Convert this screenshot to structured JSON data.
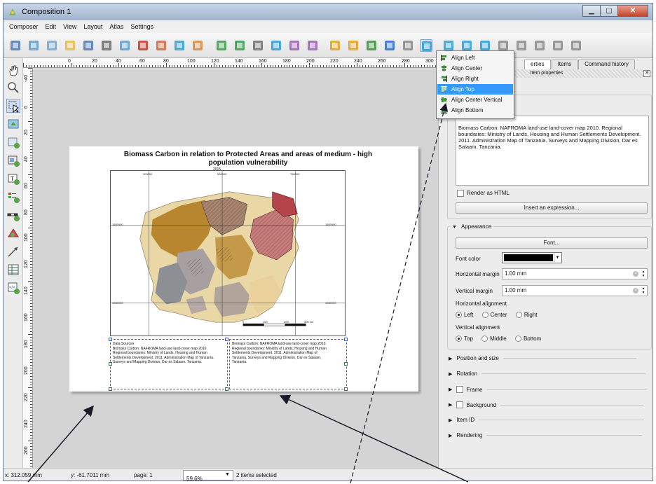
{
  "window": {
    "title": "Composition 1"
  },
  "menu": [
    "Composer",
    "Edit",
    "View",
    "Layout",
    "Atlas",
    "Settings"
  ],
  "toolbar_icons": [
    "save-icon",
    "new-composition-icon",
    "duplicate-icon",
    "manager-icon",
    "open-template-icon",
    "save-template-icon",
    "print-icon",
    "export-image-icon",
    "export-svg-icon",
    "export-pdf-icon",
    "undo-icon",
    "redo-icon",
    "zoom-full-icon",
    "zoom-in-icon",
    "zoom-out-icon",
    "zoom-100-icon",
    "refresh-icon",
    "group-icon",
    "ungroup-icon",
    "lock-icon",
    "unlock-icon",
    "raise-icon",
    "align-icon",
    "atlas-preview-icon",
    "first-feature-icon",
    "previous-feature-icon",
    "next-feature-icon",
    "last-feature-icon",
    "print-atlas-icon",
    "export-atlas-icon",
    "atlas-settings-icon"
  ],
  "ruler": {
    "h_labels": [
      "0",
      "20",
      "40",
      "60",
      "80",
      "100",
      "120",
      "140",
      "160",
      "180",
      "200",
      "220",
      "240",
      "260",
      "280",
      "300"
    ],
    "v_labels": [
      "-40",
      "0",
      "20",
      "40",
      "60",
      "80",
      "100",
      "120",
      "140",
      "160",
      "180",
      "200",
      "220",
      "240",
      "260"
    ]
  },
  "map": {
    "title": "Biomass Carbon in relation to Protected Areas and areas of medium - high population vulnerability",
    "year": "2015",
    "coords": [
      "200000",
      "500000",
      "750000",
      "1500000",
      "1250000",
      "1000000"
    ],
    "scale_labels": [
      "0",
      "100",
      "200",
      "300 km"
    ],
    "legend_left": "Data Sources:\nBiomass Carbon: NAFROMA land-use land-cover map 2010.\nRegional boundaries: Ministry of Lands, Housing and Human\nSettlements Development. 2011. Administration Map of Tanzania.\nSurveys and Mapping Division, Dar es Salaam. Tanzania.",
    "legend_right": "Biomass Carbon: NAFROMA land-use land-cover map 2010.\nRegional boundaries: Ministry of Lands, Housing and Human\nSettlements Development. 2011. Administration Map of\nTanzania. Surveys and Mapping Division, Dar es Salaam,\nTanzania."
  },
  "panel": {
    "tabs": [
      "erties",
      "Items",
      "Command history"
    ],
    "header": "Item properties",
    "label_text": "Biomass Carbon: NAFROMA land-use land-cover map 2010. Regional boundaries: Ministry of Lands, Housing and Human Settlements Development. 2011. Administration Map of Tanzania. Surveys and Mapping Division, Dar es Salaam. Tanzania.",
    "render_html": "Render as HTML",
    "insert_expression": "Insert an expression...",
    "appearance": "Appearance",
    "font_button": "Font...",
    "font_color": "Font color",
    "h_margin_label": "Horizontal margin",
    "h_margin_value": "1.00 mm",
    "v_margin_label": "Vertical margin",
    "v_margin_value": "1.00 mm",
    "h_align_label": "Horizontal alignment",
    "h_align_options": [
      "Left",
      "Center",
      "Right"
    ],
    "v_align_label": "Vertical alignment",
    "v_align_options": [
      "Top",
      "Middle",
      "Bottom"
    ],
    "sections": [
      "Position and size",
      "Rotation",
      "Frame",
      "Background",
      "Item ID",
      "Rendering"
    ]
  },
  "dropdown": {
    "items": [
      "Align Left",
      "Align Center",
      "Align Right",
      "Align Top",
      "Align Center Vertical",
      "Align Bottom"
    ],
    "highlighted": "Align Top"
  },
  "status": {
    "x": "x: 312.059 mm",
    "y": "y: -61.7011 mm",
    "page": "page: 1",
    "zoom": "59.6%",
    "selection": "2 items selected"
  },
  "colors": {
    "highlight": "#3399ff",
    "font_color": "#000000"
  }
}
